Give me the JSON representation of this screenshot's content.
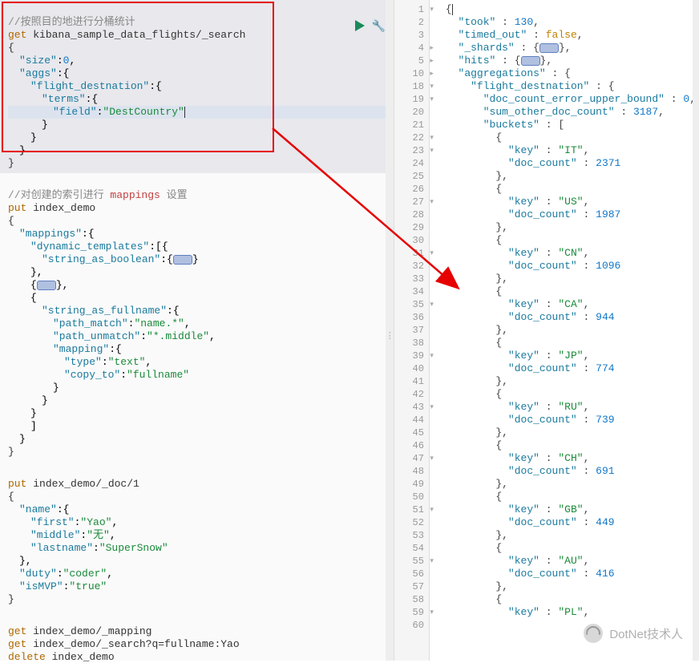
{
  "left": {
    "block1": {
      "comment": "//按照目的地进行分桶统计",
      "method": "get",
      "url": "kibana_sample_data_flights/_search",
      "sizeKey": "\"size\"",
      "sizeVal": "0",
      "aggsKey": "\"aggs\"",
      "fdKey": "\"flight_destnation\"",
      "termsKey": "\"terms\"",
      "fieldKey": "\"field\"",
      "fieldVal": "\"DestCountry\""
    },
    "block2": {
      "comment_pre": "//对创建的索引进行",
      "comment_mid": " mappings ",
      "comment_suf": "设置",
      "method": "put",
      "url": "index_demo",
      "mappingsKey": "\"mappings\"",
      "dtKey": "\"dynamic_templates\"",
      "sabKey": "\"string_as_boolean\"",
      "sfKey": "\"string_as_fullname\"",
      "pmKey": "\"path_match\"",
      "pmVal": "\"name.*\"",
      "puKey": "\"path_unmatch\"",
      "puVal": "\"*.middle\"",
      "mapKey": "\"mapping\"",
      "typeKey": "\"type\"",
      "typeVal": "\"text\"",
      "ctKey": "\"copy_to\"",
      "ctVal": "\"fullname\""
    },
    "block3": {
      "method": "put",
      "url": "index_demo/_doc/1",
      "nameKey": "\"name\"",
      "firstKey": "\"first\"",
      "firstVal": "\"Yao\"",
      "midKey": "\"middle\"",
      "midVal": "\"无\"",
      "lastKey": "\"lastname\"",
      "lastVal": "\"SuperSnow\"",
      "dutyKey": "\"duty\"",
      "dutyVal": "\"coder\"",
      "mvpKey": "\"isMVP\"",
      "mvpVal": "\"true\""
    },
    "block4": {
      "l1m": "get",
      "l1u": "index_demo/_mapping",
      "l2m": "get",
      "l2u": "index_demo/_search?q=fullname:Yao",
      "l3m": "delete",
      "l3u": "index_demo"
    }
  },
  "right": {
    "lines": [
      1,
      2,
      3,
      4,
      5,
      10,
      18,
      19,
      20,
      21,
      22,
      23,
      24,
      25,
      26,
      27,
      28,
      29,
      30,
      31,
      32,
      33,
      34,
      35,
      36,
      37,
      38,
      39,
      40,
      41,
      42,
      43,
      44,
      45,
      46,
      47,
      48,
      49,
      50,
      51,
      52,
      53,
      54,
      55,
      56,
      57,
      58,
      59,
      60
    ],
    "tookKey": "\"took\"",
    "tookVal": "130",
    "toKey": "\"timed_out\"",
    "toVal": "false",
    "shardsKey": "\"_shards\"",
    "hitsKey": "\"hits\"",
    "aggKey": "\"aggregations\"",
    "fdKey": "\"flight_destnation\"",
    "dcebKey": "\"doc_count_error_upper_bound\"",
    "dcebVal": "0",
    "sodcKey": "\"sum_other_doc_count\"",
    "sodcVal": "3187",
    "bucketsKey": "\"buckets\"",
    "keyKey": "\"key\"",
    "dcKey": "\"doc_count\"",
    "buckets": [
      {
        "key": "\"IT\"",
        "count": "2371"
      },
      {
        "key": "\"US\"",
        "count": "1987"
      },
      {
        "key": "\"CN\"",
        "count": "1096"
      },
      {
        "key": "\"CA\"",
        "count": "944"
      },
      {
        "key": "\"JP\"",
        "count": "774"
      },
      {
        "key": "\"RU\"",
        "count": "739"
      },
      {
        "key": "\"CH\"",
        "count": "691"
      },
      {
        "key": "\"GB\"",
        "count": "449"
      },
      {
        "key": "\"AU\"",
        "count": "416"
      },
      {
        "key": "\"PL\""
      }
    ]
  },
  "watermark": "DotNet技术人"
}
